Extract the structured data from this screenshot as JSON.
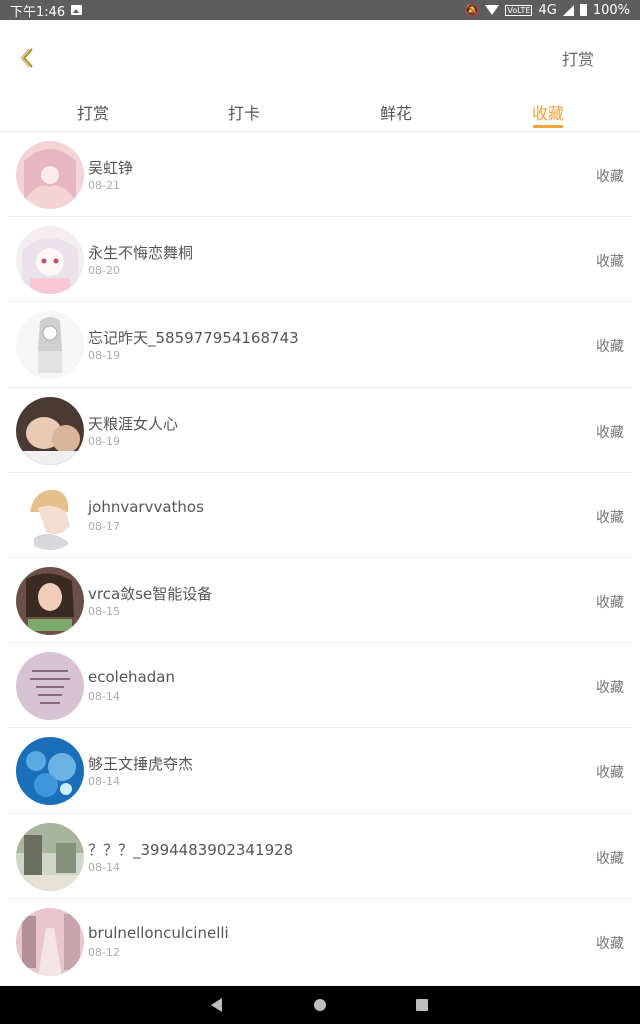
{
  "status_bar": {
    "time": "下午1:46",
    "network_label": "4G",
    "volte_label": "VoLTE",
    "battery_text": "100%"
  },
  "header": {
    "action_label": "打赏"
  },
  "tabs": [
    {
      "label": "打赏",
      "active": false
    },
    {
      "label": "打卡",
      "active": false
    },
    {
      "label": "鲜花",
      "active": false
    },
    {
      "label": "收藏",
      "active": true
    }
  ],
  "colors": {
    "accent": "#f2a33a",
    "status_bar_bg": "#5d5d5d",
    "nav_bar_bg": "#000000"
  },
  "list": [
    {
      "name": "吴虹铮",
      "date": "08-21",
      "action": "收藏"
    },
    {
      "name": "永生不悔恋舞桐",
      "date": "08-20",
      "action": "收藏"
    },
    {
      "name": "忘记昨天_585977954168743",
      "date": "08-19",
      "action": "收藏"
    },
    {
      "name": "天粮涯女人心",
      "date": "08-19",
      "action": "收藏"
    },
    {
      "name": "johnvarvvathos",
      "date": "08-17",
      "action": "收藏"
    },
    {
      "name": "vrca敛se智能设备",
      "date": "08-15",
      "action": "收藏"
    },
    {
      "name": "ecolehadan",
      "date": "08-14",
      "action": "收藏"
    },
    {
      "name": "够王文捶虎夺杰",
      "date": "08-14",
      "action": "收藏"
    },
    {
      "name": "？？？_3994483902341928",
      "date": "08-14",
      "action": "收藏"
    },
    {
      "name": "brulnellonculcinelli",
      "date": "08-12",
      "action": "收藏"
    }
  ]
}
